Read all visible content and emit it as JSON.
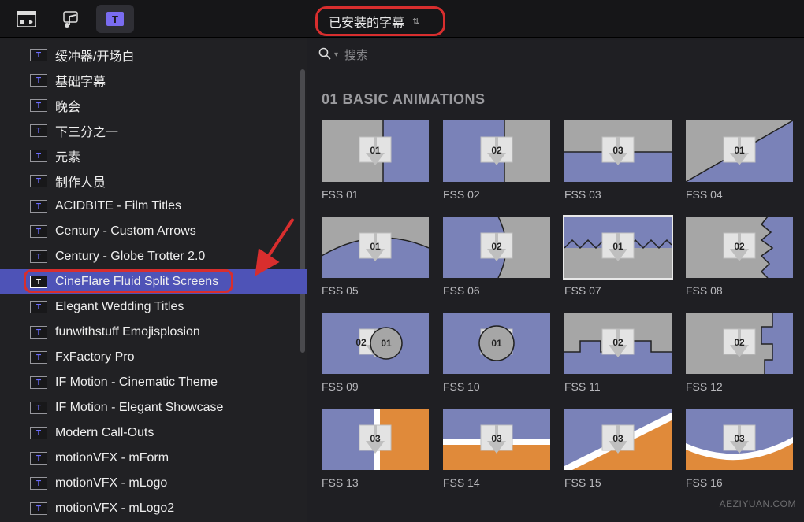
{
  "toolbar": {
    "dropdown_label": "已安装的字幕"
  },
  "sidebar": {
    "selected_index": 8,
    "items": [
      {
        "label": "缓冲器/开场白"
      },
      {
        "label": "基础字幕"
      },
      {
        "label": "晚会"
      },
      {
        "label": "下三分之一"
      },
      {
        "label": "元素"
      },
      {
        "label": "制作人员"
      },
      {
        "label": "ACIDBITE - Film Titles"
      },
      {
        "label": "Century - Custom Arrows"
      },
      {
        "label": "Century - Globe Trotter 2.0"
      },
      {
        "label": "CineFlare Fluid Split Screens"
      },
      {
        "label": "Elegant Wedding Titles"
      },
      {
        "label": "funwithstuff Emojisplosion"
      },
      {
        "label": "FxFactory Pro"
      },
      {
        "label": "IF Motion - Cinematic Theme"
      },
      {
        "label": "IF Motion - Elegant Showcase"
      },
      {
        "label": "Modern Call-Outs"
      },
      {
        "label": "motionVFX - mForm"
      },
      {
        "label": "motionVFX - mLogo"
      },
      {
        "label": "motionVFX - mLogo2"
      }
    ]
  },
  "search": {
    "placeholder": "搜索"
  },
  "section": {
    "title": "01 BASIC ANIMATIONS"
  },
  "presets": {
    "items": [
      {
        "label": "FSS 01",
        "num": "01",
        "selected": false
      },
      {
        "label": "FSS 02",
        "num": "02",
        "selected": false
      },
      {
        "label": "FSS 03",
        "num": "03",
        "selected": false
      },
      {
        "label": "FSS 04",
        "num": "01",
        "selected": false
      },
      {
        "label": "FSS 05",
        "num": "01",
        "selected": false
      },
      {
        "label": "FSS 06",
        "num": "02",
        "selected": false
      },
      {
        "label": "FSS 07",
        "num": "01",
        "selected": true
      },
      {
        "label": "FSS 08",
        "num": "02",
        "selected": false
      },
      {
        "label": "FSS 09",
        "nums": [
          "02",
          "01"
        ],
        "selected": false
      },
      {
        "label": "FSS 10",
        "num": "01",
        "selected": false
      },
      {
        "label": "FSS 11",
        "num": "02",
        "selected": false
      },
      {
        "label": "FSS 12",
        "num": "02",
        "selected": false
      },
      {
        "label": "FSS 13",
        "num": "03",
        "selected": false
      },
      {
        "label": "FSS 14",
        "num": "03",
        "selected": false
      },
      {
        "label": "FSS 15",
        "num": "03",
        "selected": false
      },
      {
        "label": "FSS 16",
        "num": "03",
        "selected": false
      }
    ]
  },
  "colors": {
    "blue": "#7a82b8",
    "orange": "#e08a3a",
    "gray": "#a6a6a6",
    "dl_light": "#e3e3e3",
    "dl_border": "#bfbfbf"
  },
  "watermark": "AEZIYUAN.COM"
}
